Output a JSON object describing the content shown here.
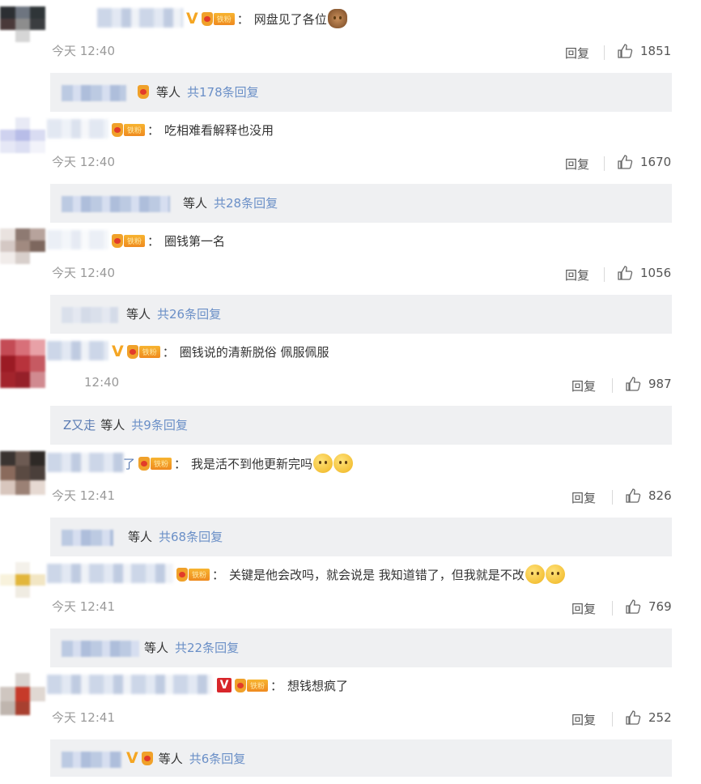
{
  "ui": {
    "reply_label": "回复",
    "others_label": "等人"
  },
  "comments": [
    {
      "text": "网盘见了各位",
      "time": "今天 12:40",
      "likes": "1851",
      "replies_summary": "共178条回复",
      "reply_name": ""
    },
    {
      "text": "吃相难看解释也没用",
      "time": "今天 12:40",
      "likes": "1670",
      "replies_summary": "共28条回复",
      "reply_name": ""
    },
    {
      "text": "圈钱第一名",
      "time": "今天 12:40",
      "likes": "1056",
      "replies_summary": "共26条回复",
      "reply_name": ""
    },
    {
      "text": "圈钱说的清新脱俗 佩服佩服",
      "time": "12:40",
      "likes": "987",
      "replies_summary": "共9条回复",
      "reply_name": "Z又走"
    },
    {
      "text": "我是活不到他更新完吗",
      "time": "今天 12:41",
      "likes": "826",
      "replies_summary": "共68条回复",
      "reply_name": ""
    },
    {
      "text": "关键是他会改吗，就会说是 我知道错了，但我就是不改",
      "time": "今天 12:41",
      "likes": "769",
      "replies_summary": "共22条回复",
      "reply_name": ""
    },
    {
      "text": "想钱想疯了",
      "time": "今天 12:41",
      "likes": "252",
      "replies_summary": "共6条回复",
      "reply_name": ""
    }
  ]
}
